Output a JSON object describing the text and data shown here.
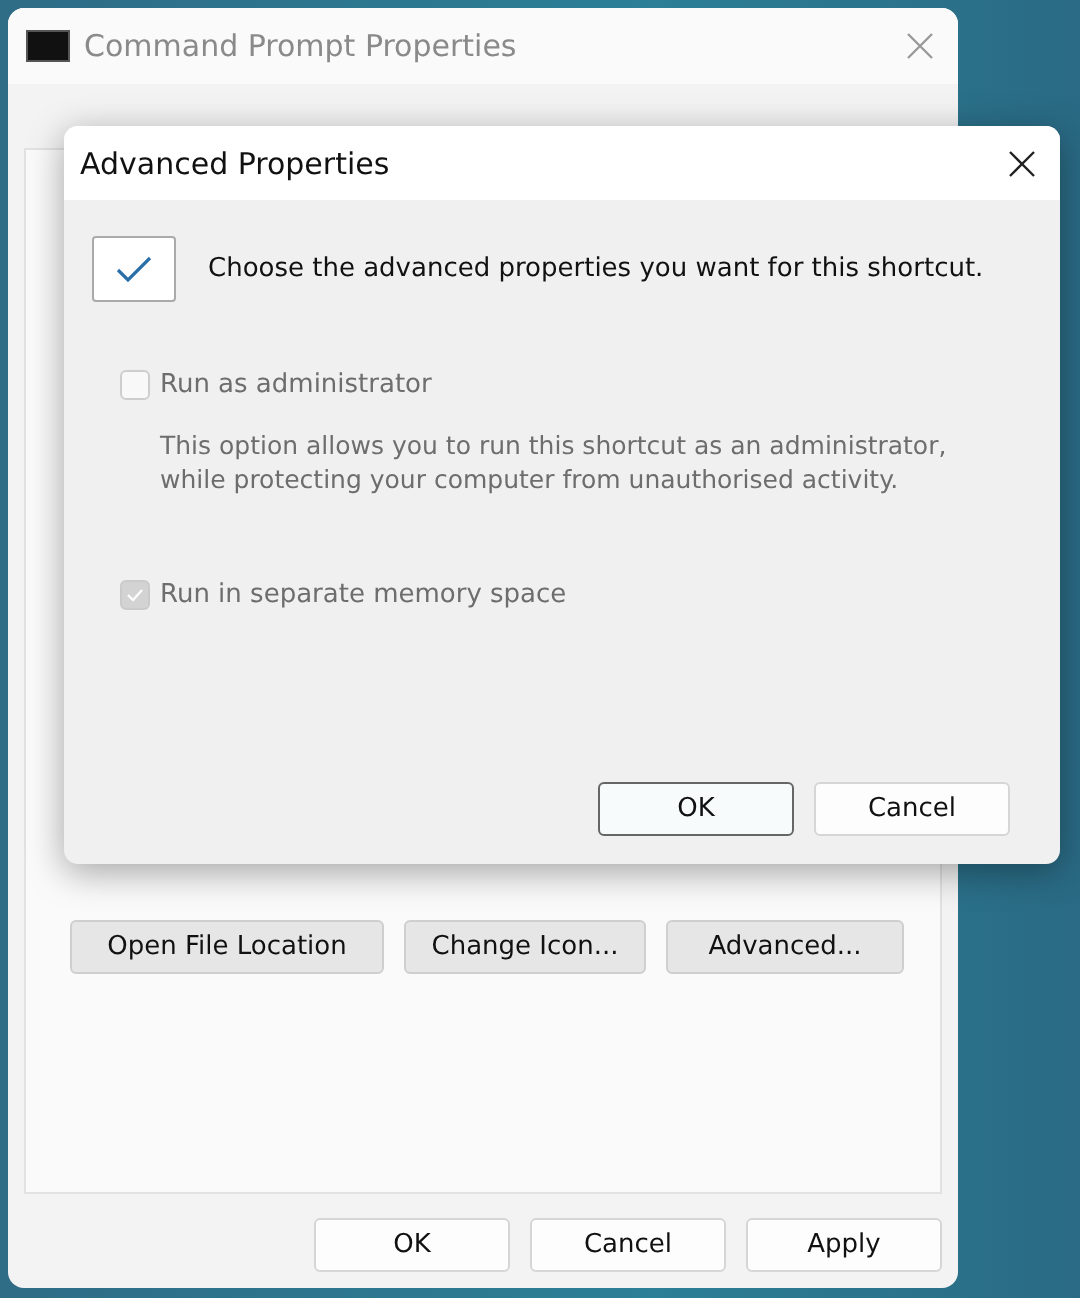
{
  "main_window": {
    "title": "Command Prompt Properties",
    "panel_buttons": [
      "Open File Location",
      "Change Icon...",
      "Advanced..."
    ],
    "buttons": [
      "OK",
      "Cancel",
      "Apply"
    ]
  },
  "dialog": {
    "title": "Advanced Properties",
    "intro": "Choose the advanced properties you want for this shortcut.",
    "options": [
      {
        "label": "Run as administrator",
        "checked": false,
        "disabled": true,
        "description": "This option allows you to run this shortcut as an administrator, while protecting your computer from unauthorised activity."
      },
      {
        "label": "Run in separate memory space",
        "checked": true,
        "disabled": true
      }
    ],
    "buttons": [
      {
        "label": "OK",
        "selected": true
      },
      {
        "label": "Cancel",
        "selected": false
      }
    ]
  }
}
